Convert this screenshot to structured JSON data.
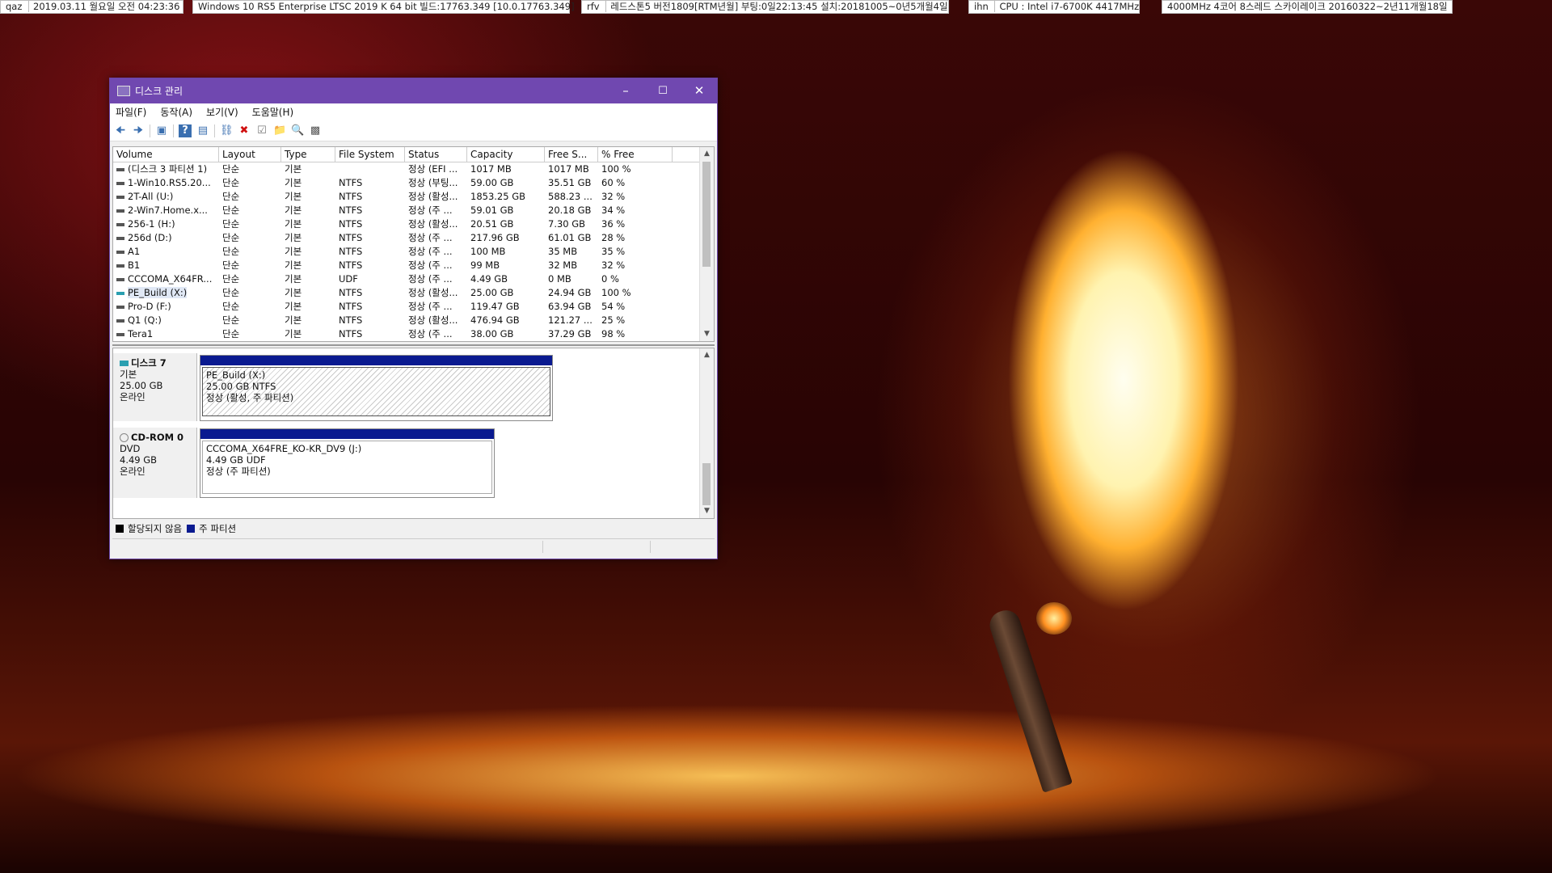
{
  "topbar": [
    {
      "label": "qaz",
      "text": "2019.03.11 월요일 오전 04:23:36"
    },
    {
      "label": "",
      "text": "Windows 10 RS5 Enterprise LTSC 2019 K 64 bit 빌드:17763.349 [10.0.17763.349]"
    },
    {
      "label": "rfv",
      "text": "레드스톤5 버전1809[RTM년월] 부팅:0일22:13:45 설치:20181005~0년5개월4일"
    },
    {
      "label": "ihn",
      "text": "CPU : Intel i7-6700K 4417MHz"
    },
    {
      "label": "",
      "text": "4000MHz 4코어 8스레드 스카이레이크 20160322~2년11개월18일"
    }
  ],
  "window": {
    "title": "디스크 관리",
    "accent": "#7048b0",
    "menu": [
      "파일(F)",
      "동작(A)",
      "보기(V)",
      "도움말(H)"
    ],
    "columns": [
      "Volume",
      "Layout",
      "Type",
      "File System",
      "Status",
      "Capacity",
      "Free S...",
      "% Free"
    ],
    "rows": [
      [
        "(디스크 3 파티션 1)",
        "단순",
        "기본",
        "",
        "정상 (EFI ...",
        "1017 MB",
        "1017 MB",
        "100 %"
      ],
      [
        "1-Win10.RS5.20...",
        "단순",
        "기본",
        "NTFS",
        "정상 (부팅...",
        "59.00 GB",
        "35.51 GB",
        "60 %"
      ],
      [
        "2T-All (U:)",
        "단순",
        "기본",
        "NTFS",
        "정상 (활성...",
        "1853.25 GB",
        "588.23 ...",
        "32 %"
      ],
      [
        "2-Win7.Home.x...",
        "단순",
        "기본",
        "NTFS",
        "정상 (주 ...",
        "59.01 GB",
        "20.18 GB",
        "34 %"
      ],
      [
        "256-1 (H:)",
        "단순",
        "기본",
        "NTFS",
        "정상 (활성...",
        "20.51 GB",
        "7.30 GB",
        "36 %"
      ],
      [
        "256d (D:)",
        "단순",
        "기본",
        "NTFS",
        "정상 (주 ...",
        "217.96 GB",
        "61.01 GB",
        "28 %"
      ],
      [
        "A1",
        "단순",
        "기본",
        "NTFS",
        "정상 (주 ...",
        "100 MB",
        "35 MB",
        "35 %"
      ],
      [
        "B1",
        "단순",
        "기본",
        "NTFS",
        "정상 (주 ...",
        "99 MB",
        "32 MB",
        "32 %"
      ],
      [
        "CCCOMA_X64FR...",
        "단순",
        "기본",
        "UDF",
        "정상 (주 ...",
        "4.49 GB",
        "0 MB",
        "0 %"
      ],
      [
        "PE_Build (X:)",
        "단순",
        "기본",
        "NTFS",
        "정상 (활성...",
        "25.00 GB",
        "24.94 GB",
        "100 %"
      ],
      [
        "Pro-D (F:)",
        "단순",
        "기본",
        "NTFS",
        "정상 (주 ...",
        "119.47 GB",
        "63.94 GB",
        "54 %"
      ],
      [
        "Q1 (Q:)",
        "단순",
        "기본",
        "NTFS",
        "정상 (활성...",
        "476.94 GB",
        "121.27 ...",
        "25 %"
      ],
      [
        "Tera1",
        "단순",
        "기본",
        "NTFS",
        "정상 (주 ...",
        "38.00 GB",
        "37.29 GB",
        "98 %"
      ]
    ],
    "disk7": {
      "name": "디스크 7",
      "type": "기본",
      "size": "25.00 GB",
      "state": "온라인",
      "partition": {
        "name": "PE_Build  (X:)",
        "size": "25.00 GB NTFS",
        "status": "정상 (활성, 주 파티션)"
      }
    },
    "cdrom0": {
      "name": "CD-ROM 0",
      "type": "DVD",
      "size": "4.49 GB",
      "state": "온라인",
      "partition": {
        "name": "CCCOMA_X64FRE_KO-KR_DV9  (J:)",
        "size": "4.49 GB UDF",
        "status": "정상 (주 파티션)"
      }
    },
    "legend": [
      {
        "label": "할당되지 않음",
        "color": "#000000"
      },
      {
        "label": "주 파티션",
        "color": "#0a1a90"
      }
    ]
  }
}
